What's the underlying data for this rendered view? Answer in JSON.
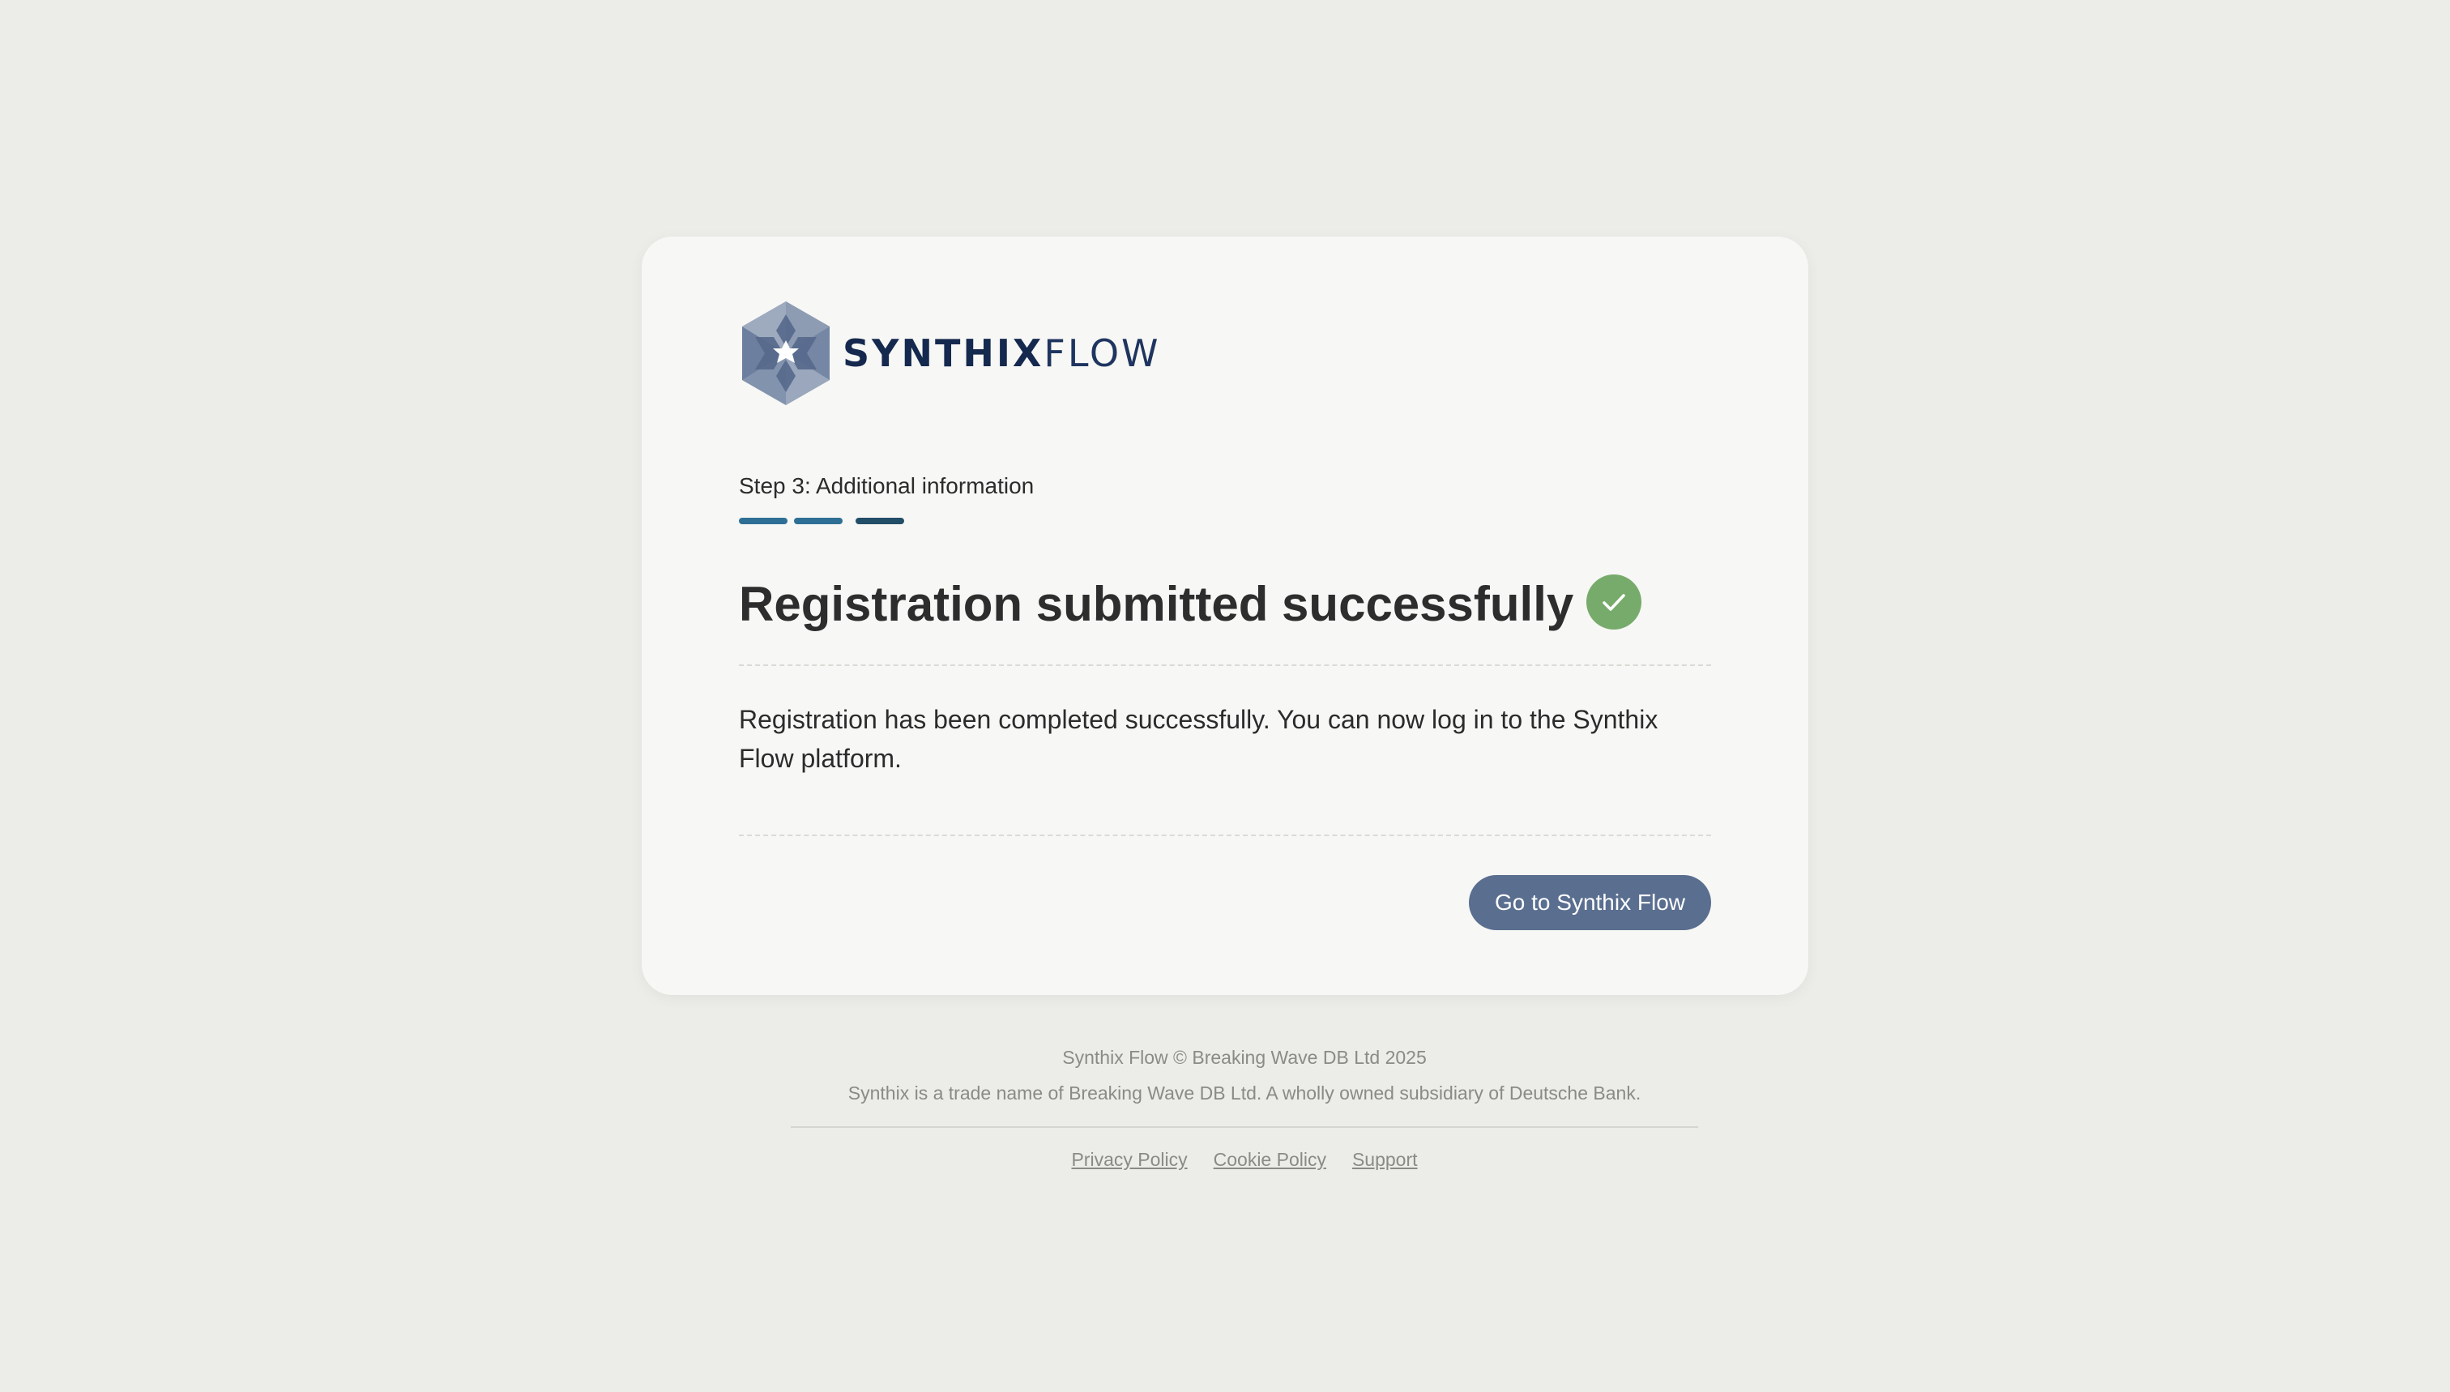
{
  "brand": {
    "name_strong": "SYNTHIX",
    "name_light": "FLOW"
  },
  "step": {
    "label": "Step 3: Additional information",
    "current": 3,
    "total": 3
  },
  "main": {
    "title": "Registration submitted successfully",
    "message": "Registration has been completed successfully. You can now log in to the Synthix Flow platform.",
    "button_label": "Go to Synthix Flow"
  },
  "footer": {
    "copyright": "Synthix Flow © Breaking Wave DB Ltd 2025",
    "legal": "Synthix is a trade name of Breaking Wave DB Ltd. A wholly owned subsidiary of Deutsche Bank.",
    "links": {
      "privacy": "Privacy Policy",
      "cookie": "Cookie Policy",
      "support": "Support"
    }
  },
  "colors": {
    "background": "#ecece8",
    "card": "#f7f7f5",
    "brand_navy": "#15294f",
    "progress_done": "#2e6f95",
    "progress_current": "#234e68",
    "success": "#77ab6b",
    "button": "#5a6e8f"
  },
  "icons": {
    "logo": "synthix-hexagon-logo",
    "status": "check-icon"
  }
}
